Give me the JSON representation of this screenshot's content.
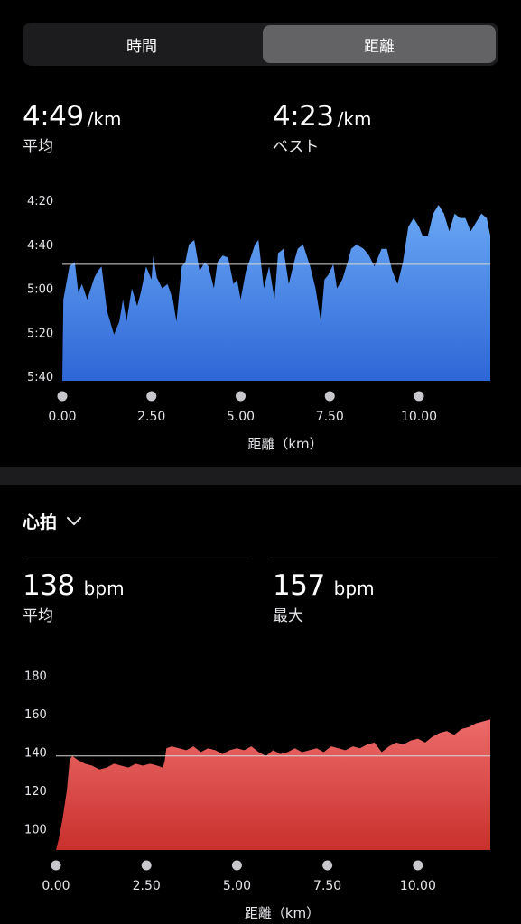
{
  "segment": {
    "time_label": "時間",
    "distance_label": "距離",
    "selected": "距離"
  },
  "pace": {
    "avg_value": "4:49",
    "avg_unit": "/km",
    "avg_label": "平均",
    "best_value": "4:23",
    "best_unit": "/km",
    "best_label": "ベスト"
  },
  "heart": {
    "section_title": "心拍",
    "avg_value": "138",
    "avg_unit": "bpm",
    "avg_label": "平均",
    "max_value": "157",
    "max_unit": "bpm",
    "max_label": "最大"
  },
  "colors": {
    "pace_top": "#6aa8f5",
    "pace_bottom": "#2f66d6",
    "hr_top": "#ec6b6b",
    "hr_bottom": "#c9302c"
  },
  "chart_data": [
    {
      "type": "area",
      "ytick_labels": [
        "4:20",
        "4:40",
        "5:00",
        "5:20",
        "5:40"
      ],
      "ytick_values": [
        260,
        280,
        300,
        320,
        340
      ],
      "ylim": [
        255,
        342
      ],
      "y_inverted": true,
      "xtick_labels": [
        "0.00",
        "2.50",
        "5.00",
        "7.50",
        "10.00"
      ],
      "xtick_values": [
        0,
        2.5,
        5,
        7.5,
        10
      ],
      "xlim": [
        0,
        12
      ],
      "xlabel": "距離（km）",
      "average_line": 289,
      "x": [
        0,
        0.03,
        0.2,
        0.35,
        0.45,
        0.55,
        0.7,
        0.9,
        1.0,
        1.1,
        1.25,
        1.45,
        1.6,
        1.7,
        1.8,
        1.95,
        2.1,
        2.2,
        2.35,
        2.5,
        2.55,
        2.65,
        2.8,
        2.95,
        3.1,
        3.2,
        3.35,
        3.45,
        3.55,
        3.7,
        3.85,
        4.0,
        4.1,
        4.25,
        4.35,
        4.5,
        4.65,
        4.8,
        4.9,
        5.0,
        5.15,
        5.3,
        5.4,
        5.5,
        5.65,
        5.8,
        5.95,
        6.05,
        6.2,
        6.35,
        6.5,
        6.6,
        6.75,
        6.95,
        7.1,
        7.25,
        7.35,
        7.45,
        7.6,
        7.7,
        7.85,
        8.0,
        8.1,
        8.25,
        8.45,
        8.6,
        8.75,
        8.95,
        9.1,
        9.25,
        9.4,
        9.55,
        9.7,
        9.85,
        10.0,
        10.1,
        10.25,
        10.4,
        10.55,
        10.7,
        10.85,
        11.0,
        11.15,
        11.3,
        11.45,
        11.6,
        11.75,
        11.9,
        12.0
      ],
      "y": [
        342,
        305,
        290,
        288,
        302,
        298,
        305,
        295,
        292,
        290,
        310,
        321,
        315,
        305,
        315,
        300,
        308,
        302,
        290,
        296,
        285,
        295,
        300,
        298,
        305,
        315,
        290,
        288,
        280,
        278,
        292,
        288,
        290,
        300,
        288,
        285,
        286,
        298,
        296,
        305,
        292,
        285,
        280,
        278,
        300,
        290,
        305,
        284,
        282,
        298,
        288,
        282,
        280,
        290,
        300,
        315,
        296,
        294,
        289,
        300,
        296,
        288,
        282,
        280,
        282,
        285,
        290,
        282,
        282,
        292,
        298,
        288,
        272,
        268,
        272,
        276,
        276,
        266,
        262,
        266,
        274,
        266,
        268,
        268,
        274,
        270,
        266,
        268,
        276
      ]
    },
    {
      "type": "area",
      "ytick_labels": [
        "180",
        "160",
        "140",
        "120",
        "100"
      ],
      "ytick_values": [
        180,
        160,
        140,
        120,
        100
      ],
      "ylim": [
        89,
        184
      ],
      "xtick_labels": [
        "0.00",
        "2.50",
        "5.00",
        "7.50",
        "10.00"
      ],
      "xtick_values": [
        0,
        2.5,
        5,
        7.5,
        10
      ],
      "xlim": [
        0,
        12
      ],
      "xlabel": "距離（km）",
      "average_line": 138,
      "x": [
        0,
        0.08,
        0.18,
        0.3,
        0.38,
        0.45,
        0.6,
        0.8,
        1.0,
        1.2,
        1.4,
        1.6,
        1.8,
        2.0,
        2.2,
        2.4,
        2.6,
        2.8,
        2.95,
        3.0,
        3.05,
        3.2,
        3.4,
        3.6,
        3.8,
        4.0,
        4.2,
        4.4,
        4.6,
        4.8,
        5.0,
        5.2,
        5.4,
        5.6,
        5.8,
        6.0,
        6.2,
        6.4,
        6.6,
        6.8,
        7.0,
        7.2,
        7.4,
        7.6,
        7.8,
        8.0,
        8.2,
        8.4,
        8.6,
        8.8,
        9.0,
        9.2,
        9.4,
        9.6,
        9.8,
        10.0,
        10.2,
        10.4,
        10.6,
        10.8,
        11.0,
        11.2,
        11.4,
        11.6,
        11.8,
        12.0
      ],
      "y": [
        89,
        95,
        105,
        120,
        136,
        138,
        136,
        134,
        133,
        131,
        132,
        134,
        133,
        132,
        134,
        133,
        134,
        133,
        132,
        135,
        142,
        143,
        142,
        141,
        143,
        140,
        142,
        141,
        139,
        141,
        142,
        141,
        143,
        140,
        138,
        141,
        139,
        140,
        142,
        140,
        141,
        142,
        140,
        143,
        142,
        141,
        143,
        142,
        144,
        145,
        140,
        143,
        145,
        144,
        146,
        147,
        145,
        148,
        150,
        151,
        149,
        152,
        153,
        155,
        156,
        157
      ]
    }
  ]
}
